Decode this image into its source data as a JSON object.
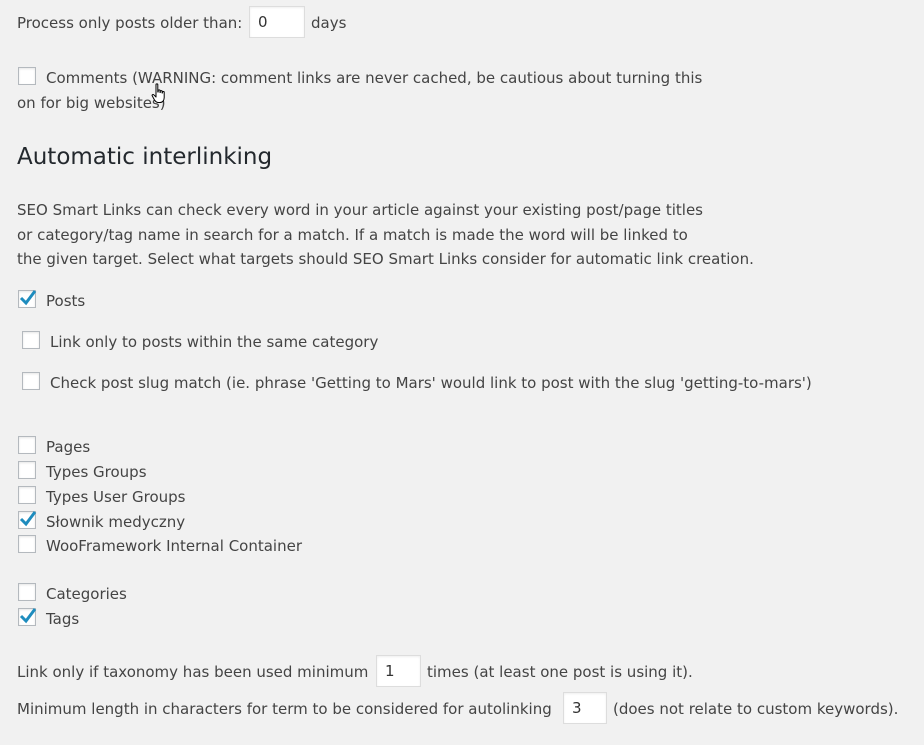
{
  "older_than": {
    "label": "Process only posts older than:",
    "value": "0",
    "unit": "days"
  },
  "comments": {
    "checked": false,
    "line1": "Comments (WARNING: comment links are never cached, be cautious about turning this",
    "line2": "on for big websites)"
  },
  "interlinking": {
    "title": "Automatic interlinking",
    "description": [
      "SEO Smart Links can check every word in your article against your existing post/page titles",
      "or category/tag name in search for a match. If a match is made the word will be linked to",
      "the given target. Select what targets should SEO Smart Links consider for automatic link creation."
    ],
    "posts": {
      "label": "Posts",
      "checked": true
    },
    "same_category": {
      "label": "Link only to posts within the same category",
      "checked": false
    },
    "slug_match": {
      "label": "Check post slug match (ie. phrase 'Getting to Mars' would link to post with the slug 'getting-to-mars')",
      "checked": false
    },
    "post_types": [
      {
        "label": "Pages",
        "checked": false
      },
      {
        "label": "Types Groups",
        "checked": false
      },
      {
        "label": "Types User Groups",
        "checked": false
      },
      {
        "label": "Słownik medyczny",
        "checked": true
      },
      {
        "label": "WooFramework Internal Container",
        "checked": false
      }
    ],
    "taxonomies": [
      {
        "label": "Categories",
        "checked": false
      },
      {
        "label": "Tags",
        "checked": true
      }
    ],
    "min_usage": {
      "label": "Link only if taxonomy has been used minimum",
      "value": "1",
      "suffix": "times (at least one post is using it)."
    },
    "min_length": {
      "label": "Minimum length in characters for term to be considered for autolinking",
      "value": "3",
      "suffix": "(does not relate to custom keywords)."
    }
  },
  "colors": {
    "background": "#f1f1f1",
    "text": "#444444",
    "heading": "#23282d",
    "checkmark": "#1e8cbe"
  },
  "icons": {
    "checkmark": "checkmark-icon",
    "cursor": "hand-pointer-cursor-icon"
  }
}
